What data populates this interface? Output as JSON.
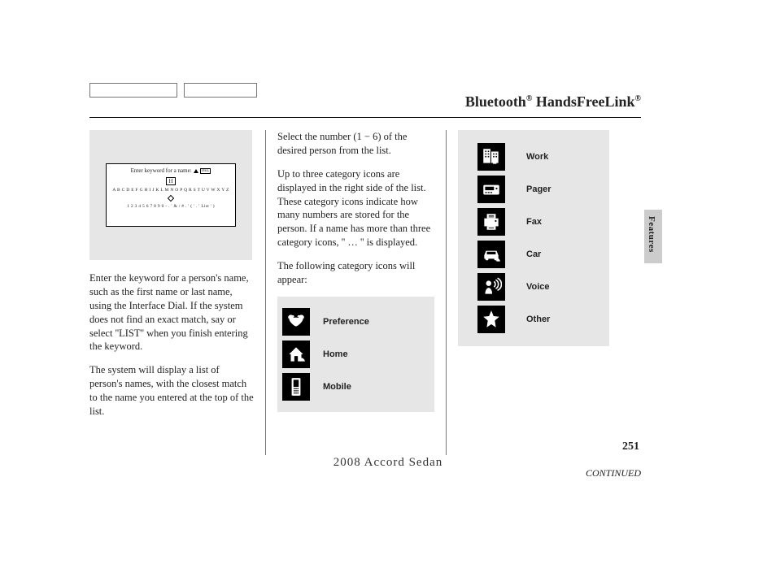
{
  "header": {
    "title_a": "Bluetooth",
    "reg": "®",
    "title_b": " HandsFreeLink",
    "reg2": "®"
  },
  "screen": {
    "prompt": "Enter keyword for a name:",
    "del": "DEL",
    "letter": "H",
    "row_alpha": "A B C D E F G H I J K L M N O P Q R S T U V W X Y Z",
    "row_num": "1 2 3 4 5 6 7 8 9 0 - . ' & / # . ' ( ' . ' List ' )"
  },
  "col1": {
    "p1": "Enter the keyword for a person's name, such as the first name or last name, using the Interface Dial. If the system does not find an exact match, say or select ''LIST'' when you finish entering the keyword.",
    "p2": "The system will display a list of person's names, with the closest match to the name you entered at the top of the list."
  },
  "col2": {
    "p1": "Select the number (1 − 6) of the desired person from the list.",
    "p2": "Up to three category icons are displayed in the right side of the list. These category icons indicate how many numbers are stored for the person. If a name has more than three category icons, '' … '' is displayed.",
    "p3": "The following category icons will appear:",
    "icons": [
      {
        "name": "preference-icon",
        "label": "Preference"
      },
      {
        "name": "home-icon",
        "label": "Home"
      },
      {
        "name": "mobile-icon",
        "label": "Mobile"
      }
    ]
  },
  "col3": {
    "icons": [
      {
        "name": "work-icon",
        "label": "Work"
      },
      {
        "name": "pager-icon",
        "label": "Pager"
      },
      {
        "name": "fax-icon",
        "label": "Fax"
      },
      {
        "name": "car-icon",
        "label": "Car"
      },
      {
        "name": "voice-icon",
        "label": "Voice"
      },
      {
        "name": "other-icon",
        "label": "Other"
      }
    ]
  },
  "continued": "CONTINUED",
  "side_label": "Features",
  "page_num": "251",
  "footer": "2008  Accord  Sedan"
}
